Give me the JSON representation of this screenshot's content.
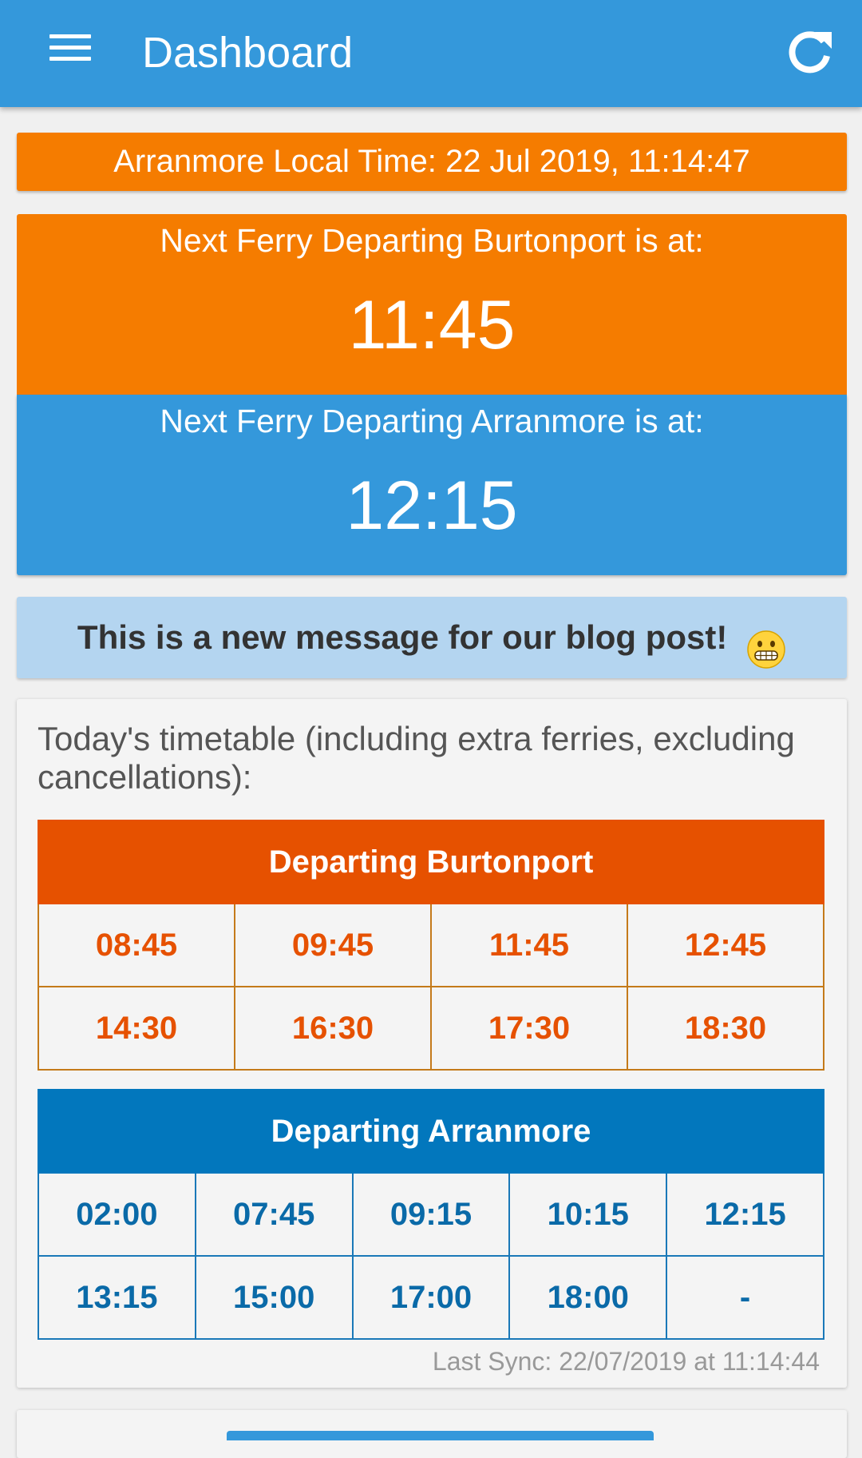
{
  "app_bar": {
    "title": "Dashboard",
    "menu_icon": "hamburger-menu-icon",
    "refresh_icon": "refresh-icon",
    "background_color": "#3498db"
  },
  "local_time": {
    "text": "Arranmore Local Time: 22 Jul 2019, 11:14:47"
  },
  "next_ferry": {
    "burtonport": {
      "label": "Next Ferry Departing Burtonport is at:",
      "time": "11:45",
      "color": "#f57c00"
    },
    "arranmore": {
      "label": "Next Ferry Departing Arranmore is at:",
      "time": "12:15",
      "color": "#3498db"
    }
  },
  "message": {
    "text": "This is a new message for our blog post!",
    "emoji_icon": "grinning-face-emoji-icon"
  },
  "timetable": {
    "intro": "Today's timetable (including extra ferries, excluding cancellations):",
    "burtonport": {
      "heading": "Departing Burtonport",
      "color": "#e65100",
      "rows": [
        [
          "08:45",
          "09:45",
          "11:45",
          "12:45"
        ],
        [
          "14:30",
          "16:30",
          "17:30",
          "18:30"
        ]
      ]
    },
    "arranmore": {
      "heading": "Departing Arranmore",
      "color": "#0277bd",
      "rows": [
        [
          "02:00",
          "07:45",
          "09:15",
          "10:15",
          "12:15"
        ],
        [
          "13:15",
          "15:00",
          "17:00",
          "18:00",
          "-"
        ]
      ]
    },
    "last_sync": "Last Sync: 22/07/2019 at 11:14:44"
  }
}
